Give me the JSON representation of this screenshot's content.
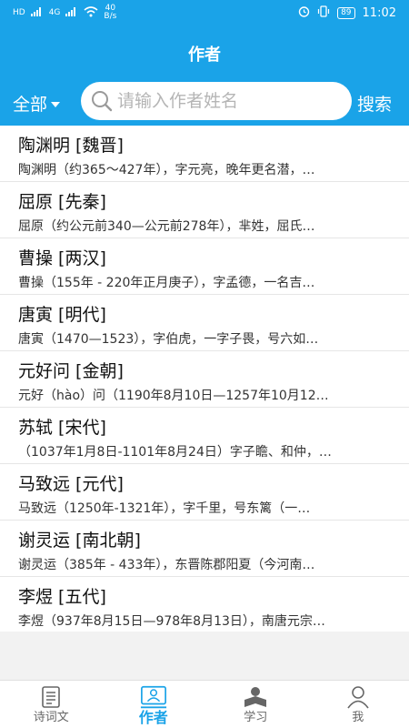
{
  "status": {
    "signal_left": "HD",
    "signal_net": "4G",
    "speed": "40\nB/s",
    "battery": "89",
    "time": "11:02"
  },
  "header": {
    "title": "作者",
    "filter_label": "全部",
    "search_placeholder": "请输入作者姓名",
    "search_button": "搜索"
  },
  "authors": [
    {
      "title": "陶渊明 [魏晋]",
      "desc": "陶渊明（约365～427年），字元亮，晚年更名潜，…"
    },
    {
      "title": "屈原 [先秦]",
      "desc": "屈原（约公元前340—公元前278年），芈姓，屈氏…"
    },
    {
      "title": "曹操 [两汉]",
      "desc": "曹操（155年 - 220年正月庚子），字孟德，一名吉…"
    },
    {
      "title": "唐寅 [明代]",
      "desc": "唐寅（1470—1523），字伯虎，一字子畏，号六如…"
    },
    {
      "title": "元好问 [金朝]",
      "desc": "元好（hào）问（1190年8月10日—1257年10月12…"
    },
    {
      "title": "苏轼 [宋代]",
      "desc": "（1037年1月8日-1101年8月24日）字子瞻、和仲，…"
    },
    {
      "title": "马致远 [元代]",
      "desc": "马致远（1250年-1321年），字千里，号东篱（一…"
    },
    {
      "title": "谢灵运 [南北朝]",
      "desc": "谢灵运（385年 - 433年），东晋陈郡阳夏（今河南…"
    },
    {
      "title": "李煜 [五代]",
      "desc": "李煜（937年8月15日—978年8月13日），南唐元宗…"
    }
  ],
  "nav": [
    {
      "label": "诗词文",
      "icon": "document-icon"
    },
    {
      "label": "作者",
      "icon": "author-card-icon"
    },
    {
      "label": "学习",
      "icon": "study-icon"
    },
    {
      "label": "我",
      "icon": "person-icon"
    }
  ],
  "colors": {
    "primary": "#1aa3e8"
  }
}
